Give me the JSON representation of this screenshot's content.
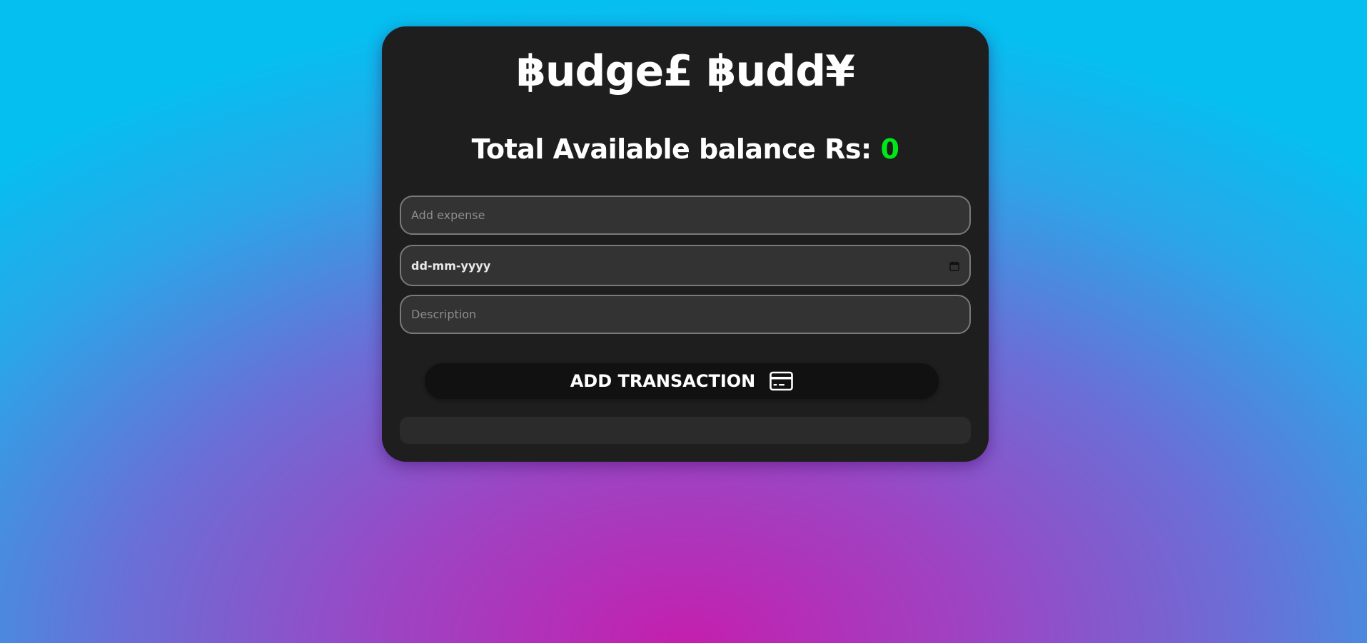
{
  "app": {
    "title": "฿udge£ ฿udd¥"
  },
  "balance": {
    "label": "Total Available balance Rs: ",
    "amount": "0",
    "amount_color": "#00e619"
  },
  "form": {
    "expense_placeholder": "Add expense",
    "date_value": "dd-mm-yyyy",
    "description_placeholder": "Description"
  },
  "actions": {
    "add_label": "ADD TRANSACTION",
    "add_icon": "credit-card-icon"
  },
  "transactions": {
    "items": []
  },
  "theme": {
    "card_bg": "#1e1e1e",
    "field_bg": "#333333",
    "button_bg": "#111111",
    "gradient_center": "#c41fae",
    "gradient_edge": "#05bff0"
  }
}
